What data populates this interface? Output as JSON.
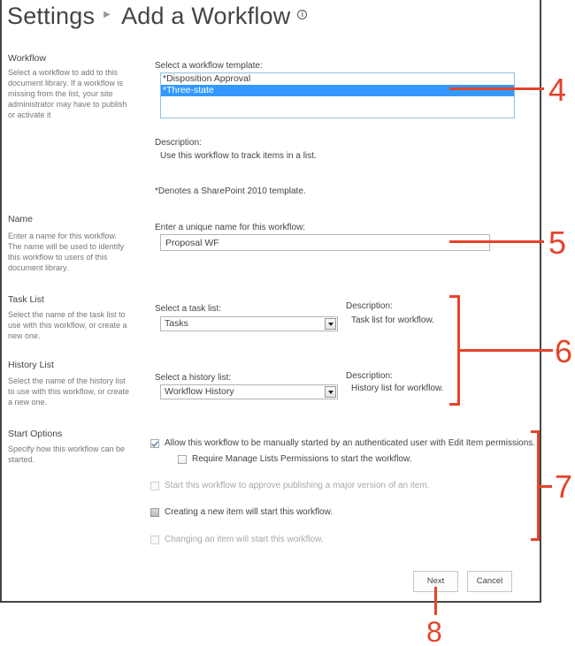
{
  "header": {
    "breadcrumb_root": "Settings",
    "page_title": "Add a Workflow",
    "separator_icon": "triangle-right-icon",
    "info_icon": "info-circle-icon"
  },
  "sections": {
    "workflow": {
      "title": "Workflow",
      "description": "Select a workflow to add to this document library. If a workflow is missing from the list, your site administrator may have to publish or activate it",
      "field_label": "Select a workflow template:",
      "options": [
        "*Disposition Approval",
        "*Three-state"
      ],
      "selected_index": 1,
      "description_label": "Description:",
      "description_value": "Use this workflow to track items in a list.",
      "footnote": "*Denotes a SharePoint 2010 template."
    },
    "name": {
      "title": "Name",
      "description": "Enter a name for this workflow. The name will be used to identify this workflow to users of this document library.",
      "field_label": "Enter a unique name for this workflow:",
      "value": "Proposal WF"
    },
    "task_list": {
      "title": "Task List",
      "description": "Select the name of the task list to use with this workflow, or create a new one.",
      "field_label": "Select a task list:",
      "selected": "Tasks",
      "description_label": "Description:",
      "description_value": "Task list for workflow."
    },
    "history_list": {
      "title": "History List",
      "description": "Select the name of the history list to use with this workflow, or create a new one.",
      "field_label": "Select a history list:",
      "selected": "Workflow History",
      "description_label": "Description:",
      "description_value": "History list for workflow."
    },
    "start_options": {
      "title": "Start Options",
      "description": "Specify how this workflow can be started.",
      "options": [
        {
          "label": "Allow this workflow to be manually started by an authenticated user with Edit Item permissions.",
          "checked": true,
          "enabled": true
        },
        {
          "label": "Require Manage Lists Permissions to start the workflow.",
          "checked": false,
          "enabled": true
        },
        {
          "label": "Start this workflow to approve publishing a major version of an item.",
          "checked": false,
          "enabled": false
        },
        {
          "label": "Creating a new item will start this workflow.",
          "checked": false,
          "enabled": true
        },
        {
          "label": "Changing an item will start this workflow.",
          "checked": false,
          "enabled": false
        }
      ]
    }
  },
  "buttons": {
    "next": "Next",
    "cancel": "Cancel"
  },
  "annotations": {
    "color": "#e5432a",
    "callouts": [
      "4",
      "5",
      "6",
      "7",
      "8"
    ]
  }
}
